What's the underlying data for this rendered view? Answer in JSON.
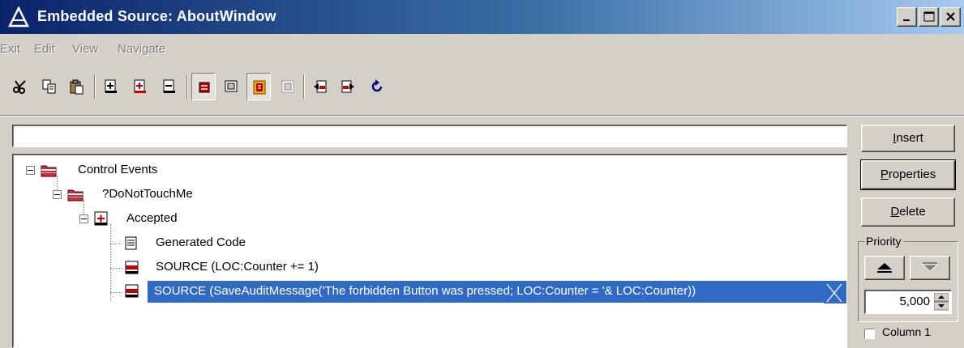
{
  "window": {
    "title": "Embedded Source: AboutWindow",
    "app_icon": "clarion-triangle-icon",
    "controls": [
      "minimize-icon",
      "maximize-icon",
      "close-icon"
    ]
  },
  "menu": {
    "items": [
      "Exit",
      "Edit",
      "View",
      "Navigate"
    ]
  },
  "toolbar": {
    "buttons": [
      {
        "icon": "cut-icon"
      },
      {
        "icon": "copy-icon"
      },
      {
        "icon": "paste-icon"
      },
      {
        "icon": "embed-add-icon"
      },
      {
        "icon": "embed-add-red-icon"
      },
      {
        "icon": "embed-remove-icon"
      },
      {
        "icon": "filled-embeds-icon",
        "pressed": true
      },
      {
        "icon": "show-all-icon"
      },
      {
        "icon": "source-icon",
        "pressed": true
      },
      {
        "icon": "generated-code-icon"
      },
      {
        "icon": "previous-filled-icon"
      },
      {
        "icon": "next-filled-icon"
      },
      {
        "icon": "refresh-icon"
      }
    ]
  },
  "search": {
    "value": ""
  },
  "tree": {
    "items": [
      {
        "label": "Control Events",
        "icon": "folder-icon",
        "expanded": true
      },
      {
        "label": "?DoNotTouchMe",
        "icon": "folder-icon",
        "expanded": true
      },
      {
        "label": "Accepted",
        "icon": "event-icon",
        "expanded": true
      },
      {
        "label": "Generated Code",
        "icon": "generated-code-icon"
      },
      {
        "label": "SOURCE (LOC:Counter += 1)",
        "icon": "source-icon"
      },
      {
        "label": "SOURCE (SaveAuditMessage('The forbidden Button was pressed; LOC:Counter = '& LOC:Counter))",
        "icon": "source-icon",
        "selected": true
      }
    ]
  },
  "buttons": {
    "insert": {
      "pre": "",
      "accel": "I",
      "post": "nsert"
    },
    "properties": {
      "pre": "",
      "accel": "P",
      "post": "roperties"
    },
    "delete": {
      "pre": "",
      "accel": "D",
      "post": "elete"
    }
  },
  "priority": {
    "label": "Priority",
    "value": "5,000",
    "column_label": "Column 1"
  },
  "colors": {
    "title_start": "#0a246a",
    "title_end": "#a6caf0",
    "selection": "#316ac5",
    "face": "#d4d0c8"
  }
}
